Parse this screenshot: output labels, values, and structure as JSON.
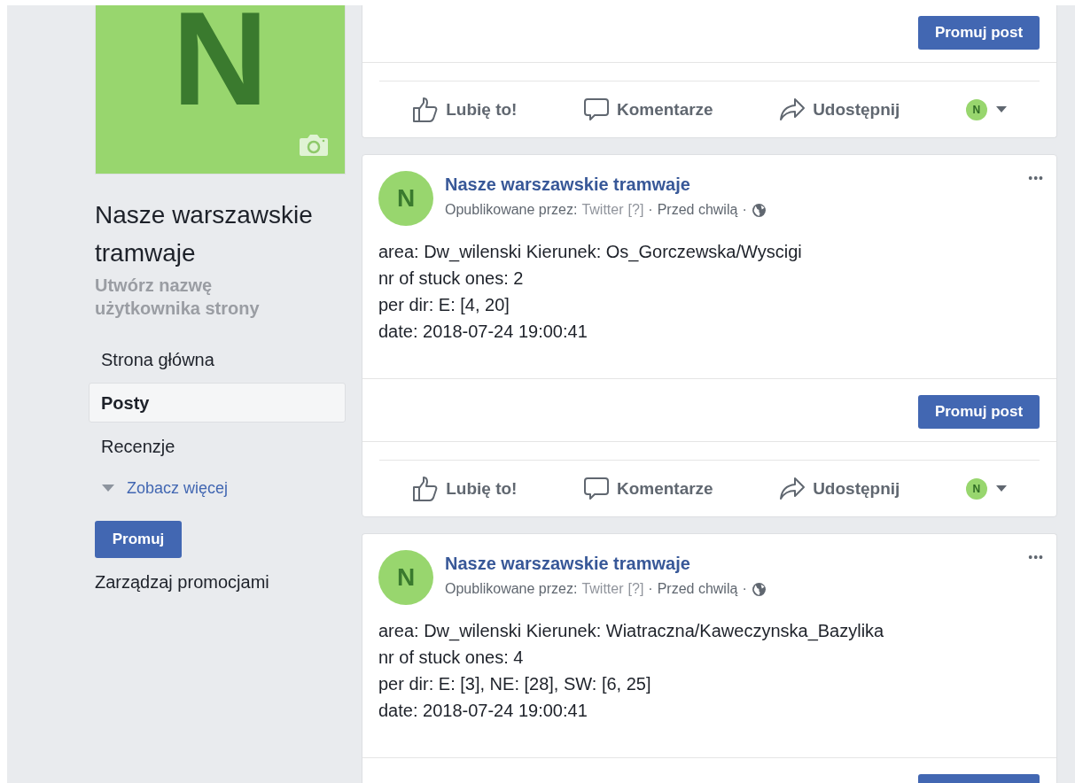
{
  "sidebar": {
    "avatar_letter": "N",
    "page_name": "Nasze warszawskie tramwaje",
    "username_link": "Utwórz nazwę użytkownika strony",
    "nav": [
      {
        "label": "Strona główna",
        "selected": false
      },
      {
        "label": "Posty",
        "selected": true
      },
      {
        "label": "Recenzje",
        "selected": false
      }
    ],
    "see_more": "Zobacz więcej",
    "promote_button": "Promuj",
    "manage_promotions": "Zarządzaj promocjami"
  },
  "posts": [
    {
      "kind": "tail",
      "promote_button": "Promuj post",
      "actions": [
        "Lubię to!",
        "Komentarze",
        "Udostępnij"
      ],
      "actor_letter": "N"
    },
    {
      "kind": "full",
      "avatar_letter": "N",
      "author": "Nasze warszawskie tramwaje",
      "published_by": "Opublikowane przez:",
      "app": "Twitter",
      "help": "[?]",
      "time": "Przed chwilą",
      "separator": "·",
      "more": "•••",
      "body": [
        "area: Dw_wilenski Kierunek: Os_Gorczewska/Wyscigi",
        "nr of stuck ones: 2",
        "per dir: E: [4, 20]",
        "date: 2018-07-24 19:00:41"
      ],
      "promote_button": "Promuj post",
      "actions": [
        "Lubię to!",
        "Komentarze",
        "Udostępnij"
      ],
      "actor_letter": "N"
    },
    {
      "kind": "head",
      "avatar_letter": "N",
      "author": "Nasze warszawskie tramwaje",
      "published_by": "Opublikowane przez:",
      "app": "Twitter",
      "help": "[?]",
      "time": "Przed chwilą",
      "separator": "·",
      "more": "•••",
      "body": [
        "area: Dw_wilenski Kierunek: Wiatraczna/Kaweczynska_Bazylika",
        "nr of stuck ones: 4",
        "per dir: E: [3], NE: [28], SW: [6, 25]",
        "date: 2018-07-24 19:00:41"
      ]
    }
  ]
}
